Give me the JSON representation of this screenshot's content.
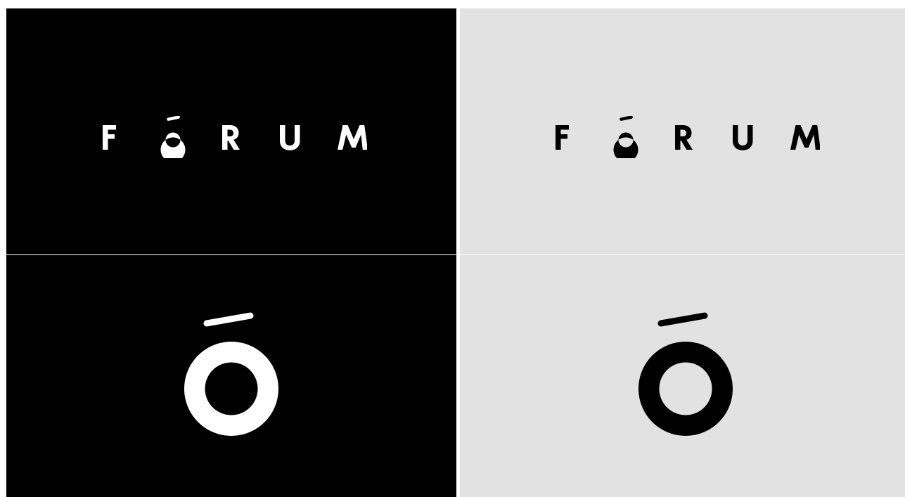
{
  "logo": {
    "wordmark_text": "FÓRUM",
    "symbol_text": "Ó"
  },
  "panels": [
    {
      "name": "wordmark-dark",
      "background": "#000000",
      "foreground": "#ffffff"
    },
    {
      "name": "wordmark-light",
      "background": "#e2e2e2",
      "foreground": "#000000"
    },
    {
      "name": "symbol-dark",
      "background": "#000000",
      "foreground": "#ffffff"
    },
    {
      "name": "symbol-light",
      "background": "#e2e2e2",
      "foreground": "#000000"
    }
  ]
}
